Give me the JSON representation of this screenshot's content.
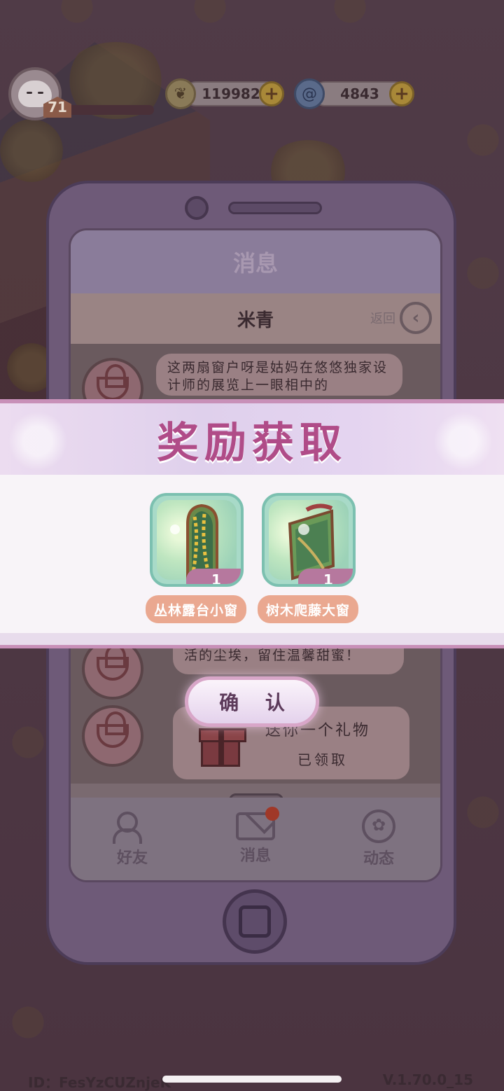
{
  "hud": {
    "level": "71",
    "currency_1": {
      "icon": "leaf-coin-icon",
      "value": "119982"
    },
    "currency_2": {
      "icon": "spiral-gem-icon",
      "value": "4843"
    },
    "plus": "+"
  },
  "phone": {
    "screen_title": "消息",
    "chat_contact": "米青",
    "back_label": "返回",
    "message_1": "这两扇窗户呀是姑妈在悠悠独家设计师的展览上一眼相中的",
    "message_2": "健康，希望这窗户能为你隔绝生活的尘埃，留住温馨甜蜜！",
    "gift_title": "送你一个礼物",
    "gift_status": "已领取",
    "nav": [
      {
        "label": "好友",
        "icon": "friends-icon"
      },
      {
        "label": "消息",
        "icon": "mail-icon"
      },
      {
        "label": "动态",
        "icon": "flower-badge-icon"
      }
    ]
  },
  "reward": {
    "title": "奖励获取",
    "items": [
      {
        "name": "丛林露台小窗",
        "count": "1"
      },
      {
        "name": "树木爬藤大窗",
        "count": "1"
      }
    ],
    "confirm_label": "确 认"
  },
  "footer": {
    "id": "ID：FesYzCUZnjeK",
    "version": "V.1.70.0_15"
  },
  "colors": {
    "title_pink": "#b04c88",
    "item_bg": "#a8dac8",
    "name_tag": "#eaa890",
    "count_tag": "#b6789e"
  }
}
